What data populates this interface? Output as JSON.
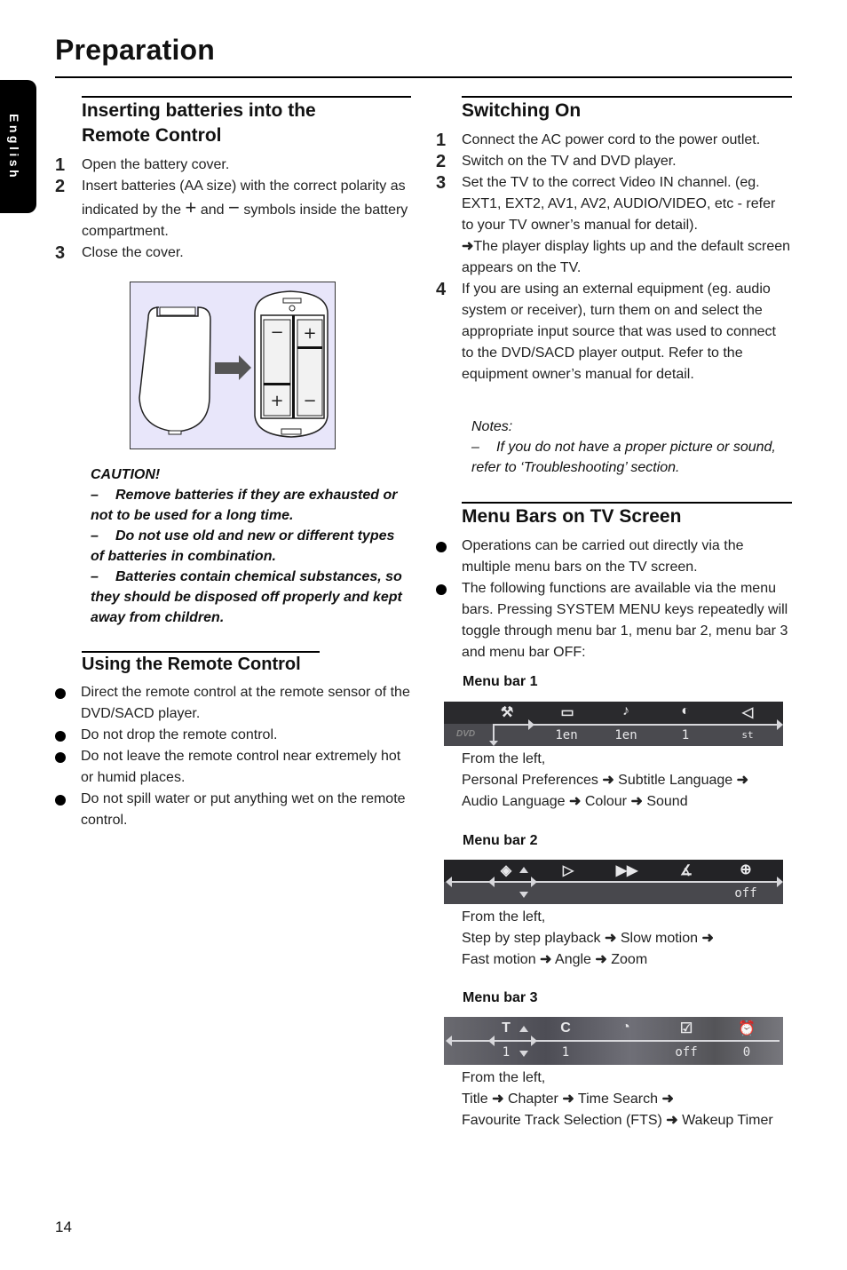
{
  "page": {
    "title": "Preparation",
    "language_tab": "English",
    "page_number": "14"
  },
  "batteries": {
    "heading_line1": "Inserting batteries into the",
    "heading_line2": "Remote Control",
    "steps": [
      {
        "num": "1",
        "text": "Open the battery cover."
      },
      {
        "num": "2",
        "text_a": "Insert batteries (AA size) with the correct polarity as indicated by the",
        "plus": "+",
        "and": "and",
        "minus": "−",
        "text_b": "symbols inside the battery compartment."
      },
      {
        "num": "3",
        "text": "Close the cover."
      }
    ],
    "figure": {
      "plus": "+",
      "minus": "−"
    },
    "caution": {
      "title": "CAUTION!",
      "items": [
        "Remove batteries if they are exhausted or not to be used for a long time.",
        "Do not use old and new or different types of batteries in combination.",
        "Batteries contain chemical substances, so they should be disposed off properly and kept away from children."
      ]
    }
  },
  "using_remote": {
    "heading": "Using the Remote Control",
    "items": [
      "Direct the remote control at the remote sensor of the DVD/SACD player.",
      "Do not drop the remote control.",
      "Do not leave the remote control near extremely hot or humid places.",
      "Do not spill water or put anything wet on the remote control."
    ]
  },
  "switching_on": {
    "heading": "Switching On",
    "steps": [
      {
        "num": "1",
        "text": "Connect the AC power cord to the power outlet."
      },
      {
        "num": "2",
        "text": "Switch on the TV and DVD player."
      },
      {
        "num": "3",
        "text": "Set the TV to the correct Video IN channel. (eg. EXT1, EXT2, AV1, AV2, AUDIO/VIDEO, etc - refer to your TV owner’s manual for detail).",
        "result": "The player display lights up and the default screen appears on the TV."
      },
      {
        "num": "4",
        "text": "If you are using an external equipment (eg. audio system or receiver), turn them on and select the appropriate input source that was used to connect to the DVD/SACD player output. Refer to the equipment owner’s manual for detail."
      }
    ],
    "notes_title": "Notes:",
    "notes_item": "If you do not have a proper picture or sound, refer to ‘Troubleshooting’ section."
  },
  "menu_bars": {
    "heading": "Menu Bars on TV Screen",
    "items": [
      "Operations can be carried out directly via the multiple menu bars on the TV screen.",
      "The following functions are available via the menu bars. Pressing SYSTEM MENU keys repeatedly will toggle through menu bar 1, menu bar 2, menu bar 3 and menu bar OFF:"
    ],
    "bar1": {
      "label": "Menu bar 1",
      "logo": "DVD",
      "icons": [
        "preferences-icon",
        "subtitle-icon",
        "audio-icon",
        "colour-icon",
        "sound-icon"
      ],
      "values": [
        "1en",
        "1en",
        "1",
        "st"
      ],
      "from": "From the left,",
      "desc": [
        "Personal Preferences",
        "Subtitle Language",
        "Audio Language",
        "Colour",
        "Sound"
      ]
    },
    "bar2": {
      "label": "Menu bar 2",
      "icons": [
        "step-icon",
        "slow-motion-icon",
        "fast-motion-icon",
        "angle-icon",
        "zoom-icon"
      ],
      "values": [
        "off"
      ],
      "from": "From the left,",
      "desc": [
        "Step by step playback",
        "Slow motion",
        "Fast motion",
        "Angle",
        "Zoom"
      ]
    },
    "bar3": {
      "label": "Menu bar 3",
      "icons_text": [
        "T",
        "C"
      ],
      "values": [
        "1",
        "1",
        "off",
        "0"
      ],
      "from": "From the left,",
      "desc": [
        "Title",
        "Chapter",
        "Time Search",
        "Favourite Track Selection (FTS)",
        "Wakeup Timer"
      ]
    },
    "arrow": "➜"
  },
  "colors": {
    "figure_bg": "#e8e6fa",
    "figure_arrow": "#555555",
    "menu_bar_dark": "#2a2a2d"
  }
}
